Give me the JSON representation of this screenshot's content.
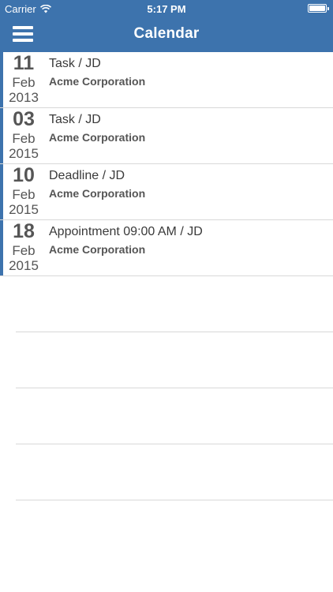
{
  "status_bar": {
    "carrier": "Carrier",
    "time": "5:17 PM",
    "wifi_icon": "wifi-icon",
    "battery_icon": "battery-icon",
    "battery_level": 1.0
  },
  "nav": {
    "title": "Calendar",
    "menu_icon": "hamburger-menu-icon"
  },
  "colors": {
    "header": "#3d73ad",
    "accent": "#3d73ad",
    "text": "#3a3a3a",
    "divider": "#d8d8d8"
  },
  "events": [
    {
      "day": "11",
      "month": "Feb",
      "year": "2013",
      "title": "Task / JD",
      "company": "Acme Corporation"
    },
    {
      "day": "03",
      "month": "Feb",
      "year": "2015",
      "title": "Task / JD",
      "company": "Acme Corporation"
    },
    {
      "day": "10",
      "month": "Feb",
      "year": "2015",
      "title": "Deadline / JD",
      "company": "Acme Corporation"
    },
    {
      "day": "18",
      "month": "Feb",
      "year": "2015",
      "title": "Appointment 09:00 AM / JD",
      "company": "Acme Corporation"
    }
  ]
}
